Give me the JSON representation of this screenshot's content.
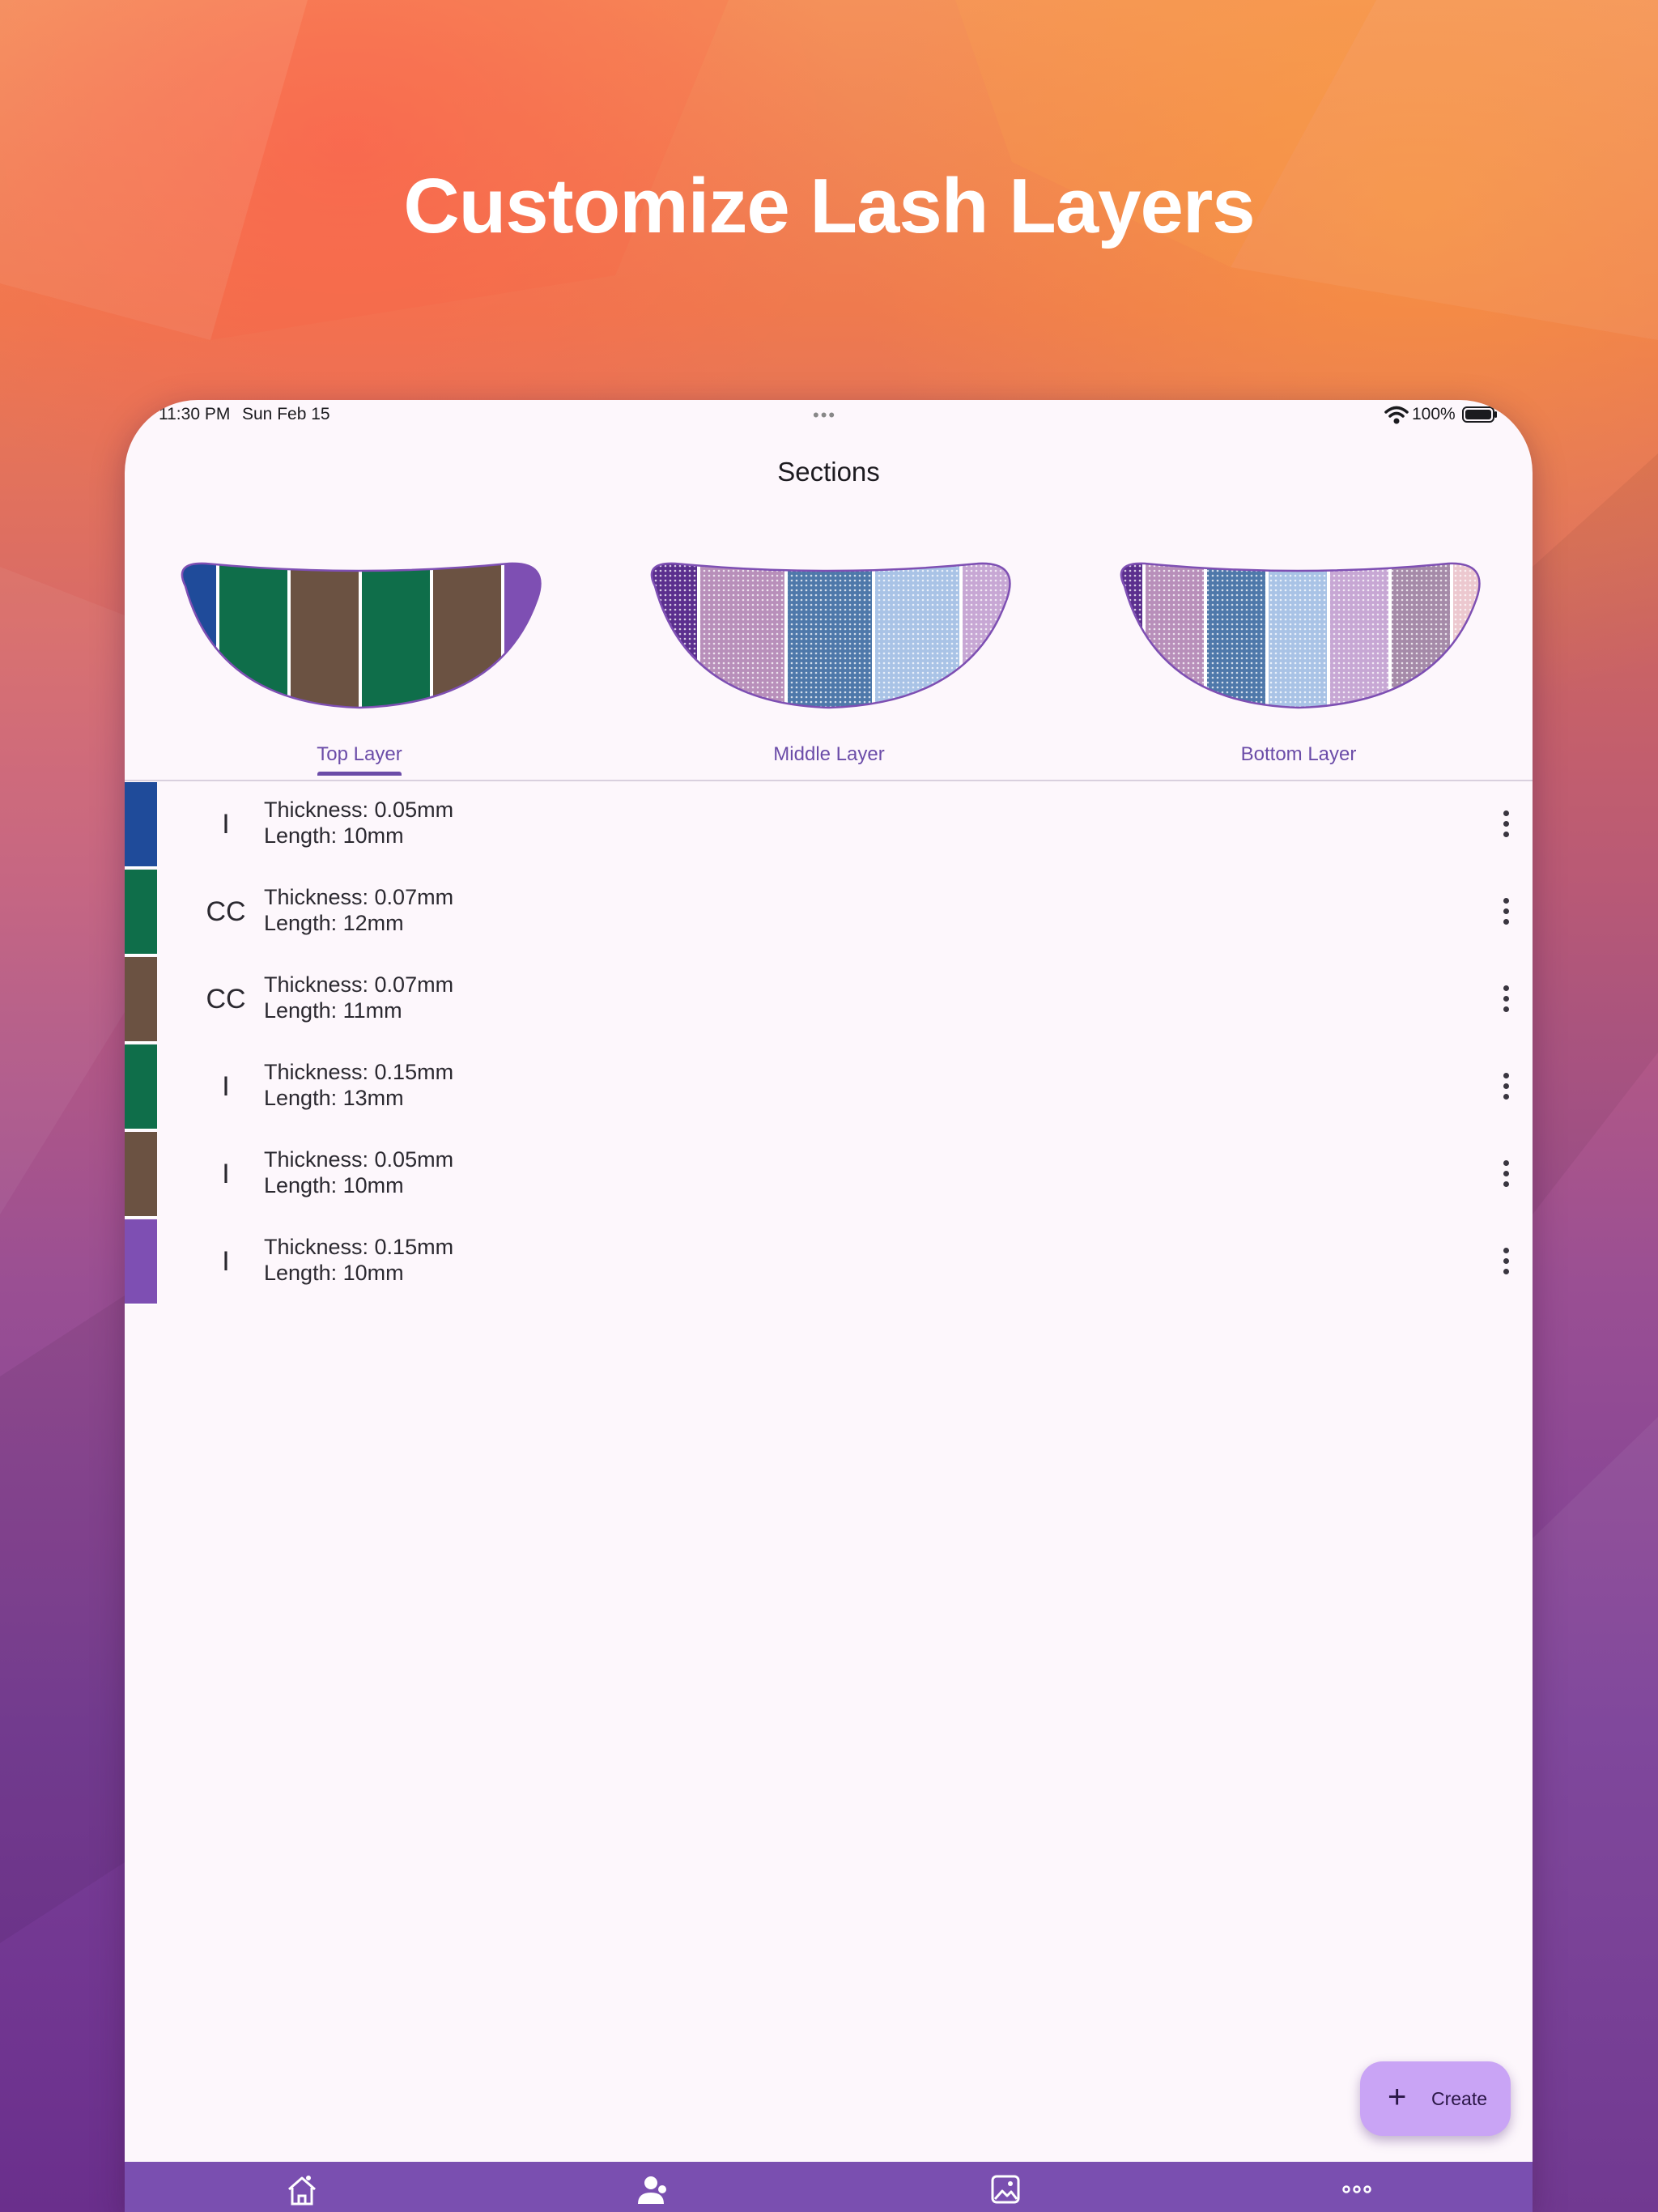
{
  "hero": {
    "title": "Customize Lash Layers"
  },
  "status_bar": {
    "time": "11:30 PM",
    "date": "Sun Feb 15",
    "battery": "100%"
  },
  "app_bar": {
    "title": "Sections"
  },
  "tabs": [
    {
      "label": "Top Layer",
      "selected": true
    },
    {
      "label": "Middle Layer",
      "selected": false
    },
    {
      "label": "Bottom Layer",
      "selected": false
    }
  ],
  "sections": [
    {
      "color": "#1f4b9a",
      "curl": "I",
      "thickness": "Thickness: 0.05mm",
      "length": "Length: 10mm"
    },
    {
      "color": "#0f6e4a",
      "curl": "CC",
      "thickness": "Thickness: 0.07mm",
      "length": "Length: 12mm"
    },
    {
      "color": "#6b5242",
      "curl": "CC",
      "thickness": "Thickness: 0.07mm",
      "length": "Length: 11mm"
    },
    {
      "color": "#0f6e4a",
      "curl": "I",
      "thickness": "Thickness: 0.15mm",
      "length": "Length: 13mm"
    },
    {
      "color": "#6b5242",
      "curl": "I",
      "thickness": "Thickness: 0.05mm",
      "length": "Length: 10mm"
    },
    {
      "color": "#7e4fb3",
      "curl": "I",
      "thickness": "Thickness: 0.15mm",
      "length": "Length: 10mm"
    }
  ],
  "fab": {
    "label": "Create"
  },
  "bottom_nav": [
    {
      "icon": "home-icon"
    },
    {
      "icon": "clients-icon"
    },
    {
      "icon": "gallery-icon"
    },
    {
      "icon": "more-icon"
    }
  ],
  "colors": {
    "accent": "#6b4ca8",
    "nav_background": "#7a4fb0",
    "fab_background": "#c9a4f5",
    "surface": "#fdf7fc"
  }
}
